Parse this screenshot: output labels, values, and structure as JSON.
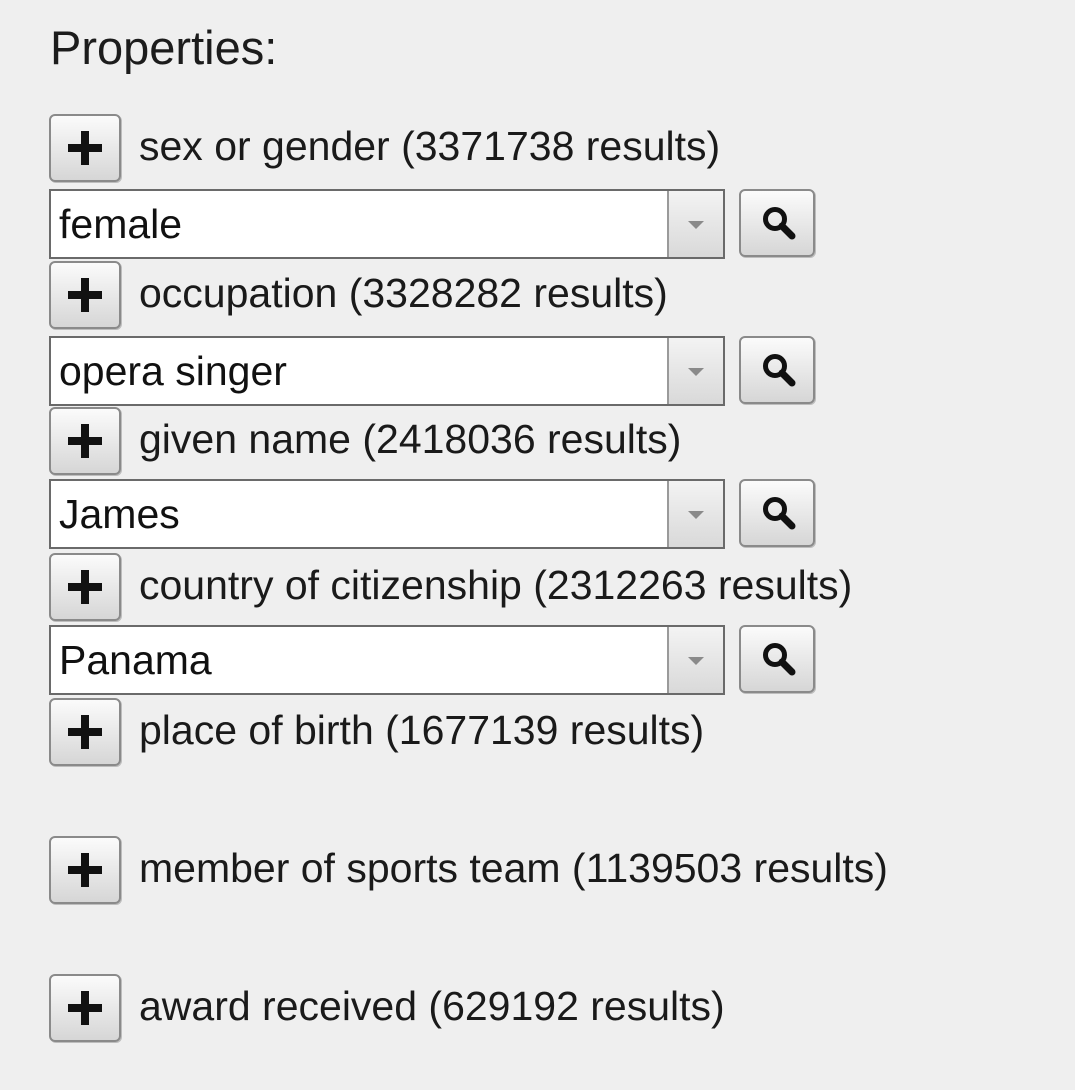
{
  "title": "Properties:",
  "properties": [
    {
      "label": "sex or gender (3371738 results)",
      "value": "female"
    },
    {
      "label": "occupation (3328282 results)",
      "value": "opera singer"
    },
    {
      "label": "given name (2418036 results)",
      "value": "James"
    },
    {
      "label": "country of citizenship (2312263 results)",
      "value": "Panama"
    },
    {
      "label": "place of birth (1677139 results)"
    },
    {
      "label": "member of sports team (1139503 results)"
    },
    {
      "label": "award received (629192 results)"
    }
  ],
  "icons": {
    "add": "plus-icon",
    "dropdown": "chevron-down-icon",
    "search": "search-icon"
  }
}
